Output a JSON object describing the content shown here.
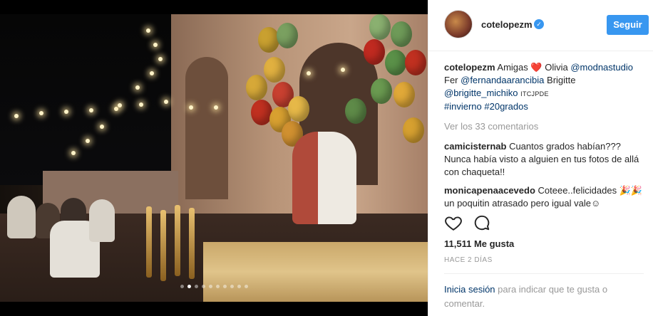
{
  "post": {
    "image_alt": "",
    "carousel": {
      "count": 10,
      "active": 1
    }
  },
  "header": {
    "username": "cotelopezm",
    "verified_icon": "verified-badge-icon",
    "follow_label": "Seguir"
  },
  "caption": {
    "user": "cotelopezm",
    "text_1": "Amigas",
    "heart": "❤",
    "heart_tail": "️ Olivia",
    "mention_1": "@modnastudio",
    "text_2": "Fer",
    "mention_2": "@fernandaarancibia",
    "text_3": "Brigitte",
    "mention_3": "@brigitte_michiko",
    "text_4": "ITC️JPDE",
    "hashtag_1": "#invierno",
    "hashtag_2": "#20grados"
  },
  "view_all": "Ver los 33 comentarios",
  "comments": [
    {
      "user": "camicisternab",
      "text": "Cuantos grados habían??? Nunca había visto a alguien en tus fotos de allá con chaqueta!!"
    },
    {
      "user": "monicapenaacevedo",
      "text": "Coteee..felicidades 🎉🎉un poquitin atrasado pero igual vale☺"
    }
  ],
  "actions": {
    "like_icon": "heart-outline-icon",
    "comment_icon": "comment-bubble-icon"
  },
  "likes": "11,511 Me gusta",
  "time_ago": "HACE 2 DÍAS",
  "footer": {
    "login_link": "Inicia sesión",
    "login_text": " para indicar que te gusta o comentar."
  },
  "colors": {
    "accent": "#3897f0",
    "link": "#003569",
    "muted": "#999999",
    "text": "#262626"
  }
}
